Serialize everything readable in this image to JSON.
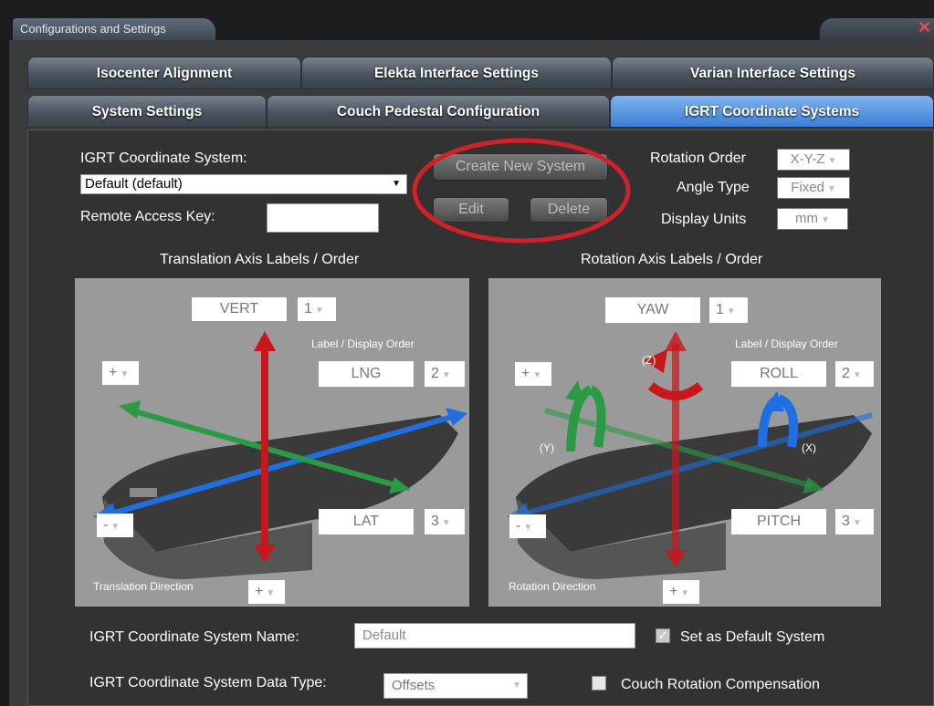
{
  "window": {
    "title": "Configurations and Settings",
    "close_glyph": "✕"
  },
  "tabs_row1": [
    {
      "label": "Isocenter Alignment"
    },
    {
      "label": "Elekta Interface Settings"
    },
    {
      "label": "Varian Interface Settings"
    }
  ],
  "tabs_row2": [
    {
      "label": "System Settings"
    },
    {
      "label": "Couch Pedestal Configuration"
    },
    {
      "label": "IGRT Coordinate Systems",
      "active": true
    }
  ],
  "form": {
    "system_label": "IGRT Coordinate System:",
    "system_value": "Default (default)",
    "remote_key_label": "Remote Access Key:",
    "remote_key_value": "",
    "create_button": "Create New System",
    "edit_button": "Edit",
    "delete_button": "Delete",
    "rotation_order_label": "Rotation Order",
    "rotation_order_value": "X-Y-Z",
    "angle_type_label": "Angle Type",
    "angle_type_value": "Fixed",
    "display_units_label": "Display Units",
    "display_units_value": "mm"
  },
  "translation": {
    "title": "Translation Axis Labels / Order",
    "order_caption": "Label / Display Order",
    "direction_caption": "Translation Direction",
    "axes": [
      {
        "label": "VERT",
        "order": "1"
      },
      {
        "label": "LNG",
        "order": "2"
      },
      {
        "label": "LAT",
        "order": "3"
      }
    ],
    "plus": "+",
    "minus": "-",
    "bottom_plus": "+"
  },
  "rotation": {
    "title": "Rotation Axis Labels / Order",
    "order_caption": "Label / Display Order",
    "direction_caption": "Rotation Direction",
    "axes": [
      {
        "label": "YAW",
        "order": "1"
      },
      {
        "label": "ROLL",
        "order": "2"
      },
      {
        "label": "PITCH",
        "order": "3"
      }
    ],
    "axis_marks": {
      "z": "(Z)",
      "y": "(Y)",
      "x": "(X)"
    },
    "plus": "+",
    "minus": "-",
    "bottom_plus": "+"
  },
  "bottom": {
    "name_label": "IGRT Coordinate System Name:",
    "name_value": "Default",
    "default_label": "Set as Default System",
    "default_checked": true,
    "data_type_label": "IGRT Coordinate System Data Type:",
    "data_type_value": "Offsets",
    "couch_comp_label": "Couch Rotation Compensation",
    "couch_comp_checked": false
  },
  "colors": {
    "active_tab": "#4a8ee0",
    "highlight_ring": "#d0202a",
    "axis_red": "#c8161b",
    "axis_blue": "#1f6fe0",
    "axis_green": "#2a9a45"
  }
}
